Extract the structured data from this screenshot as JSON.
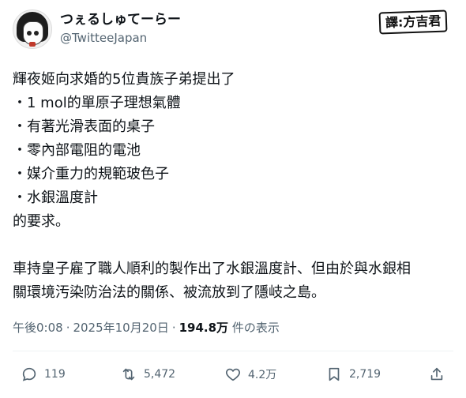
{
  "user": {
    "display_name": "つぇるしゅてーらー",
    "handle": "@TwitteeJapan"
  },
  "translator_badge": "譯:方吉君",
  "tweet": {
    "lines": [
      "輝夜姬向求婚的5位貴族子弟提出了",
      "・1 mol的單原子理想氣體",
      "・有著光滑表面的桌子",
      "・零內部電阻的電池",
      "・媒介重力的規範玻色子",
      "・水銀溫度計",
      "的要求。",
      "",
      "車持皇子雇了職人順利的製作出了水銀溫度計、但由於與水銀相",
      "關環境汚染防治法的關係、被流放到了隱岐之島。"
    ]
  },
  "meta": {
    "time": "午後0:08",
    "date": "2025年10月20日",
    "views_count": "194.8万",
    "views_label": "件の表示"
  },
  "actions": {
    "replies": "119",
    "retweets": "5,472",
    "likes": "4.2万",
    "bookmarks": "2,719"
  }
}
